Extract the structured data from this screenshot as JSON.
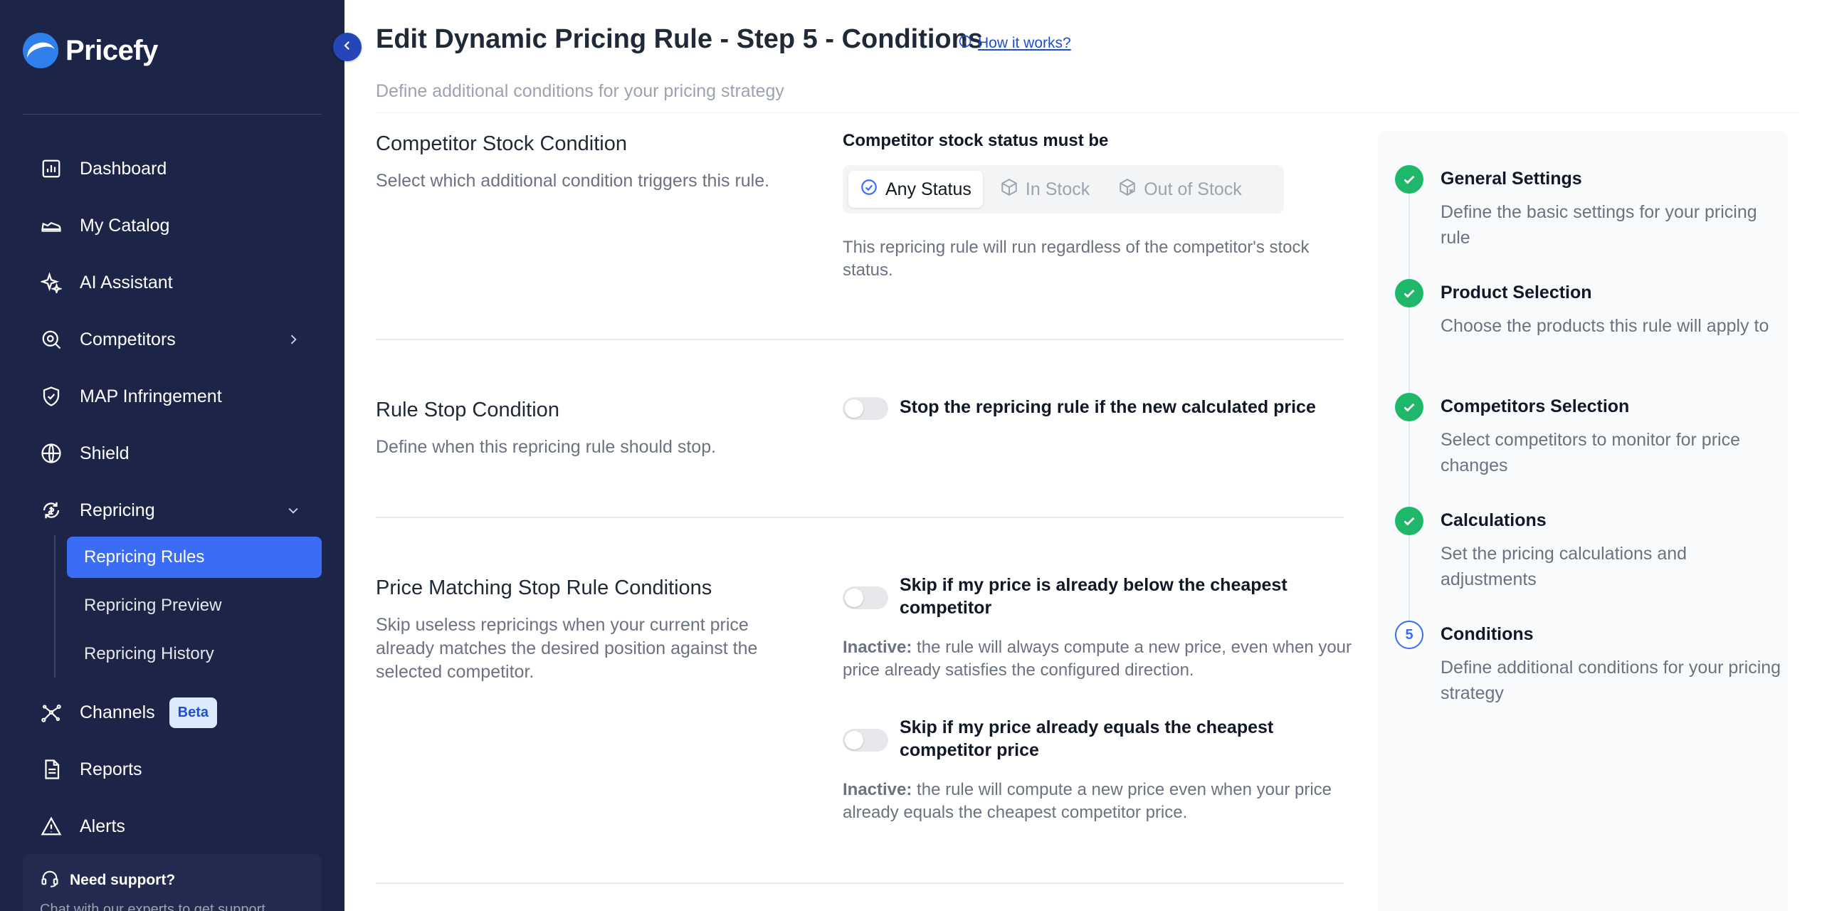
{
  "app": {
    "name": "Pricefy"
  },
  "sidebar": {
    "items": [
      {
        "label": "Dashboard"
      },
      {
        "label": "My Catalog"
      },
      {
        "label": "AI Assistant"
      },
      {
        "label": "Competitors"
      },
      {
        "label": "MAP Infringement"
      },
      {
        "label": "Shield"
      },
      {
        "label": "Repricing"
      },
      {
        "label": "Channels",
        "badge": "Beta"
      },
      {
        "label": "Reports"
      },
      {
        "label": "Alerts"
      }
    ],
    "repricing_sub": [
      {
        "label": "Repricing Rules",
        "active": true
      },
      {
        "label": "Repricing Preview"
      },
      {
        "label": "Repricing History"
      }
    ],
    "support": {
      "title": "Need support?",
      "subtitle": "Chat with our experts to get support."
    }
  },
  "header": {
    "title": "Edit Dynamic Pricing Rule - Step 5 - Conditions",
    "how_link": "How it works?",
    "subtitle": "Define additional conditions for your pricing strategy"
  },
  "sections": {
    "competitor_stock": {
      "title": "Competitor Stock Condition",
      "desc": "Select which additional condition triggers this rule.",
      "field_label": "Competitor stock status must be",
      "options": [
        "Any Status",
        "In Stock",
        "Out of Stock"
      ],
      "selected": "Any Status",
      "help": "This repricing rule will run regardless of the competitor's stock status."
    },
    "rule_stop": {
      "title": "Rule Stop Condition",
      "desc": "Define when this repricing rule should stop.",
      "toggle_label": "Stop the repricing rule if the new calculated price"
    },
    "price_matching": {
      "title": "Price Matching Stop Rule Conditions",
      "desc": "Skip useless repricings when your current price already matches the desired position against the selected competitor.",
      "toggle1_label": "Skip if my price is already below the cheapest competitor",
      "inactive_prefix": "Inactive:",
      "note1": "the rule will always compute a new price, even when your price already satisfies the configured direction.",
      "toggle2_label": "Skip if my price already equals the cheapest competitor price",
      "note2": "the rule will compute a new price even when your price already equals the cheapest competitor price."
    }
  },
  "steps": [
    {
      "title": "General Settings",
      "desc": "Define the basic settings for your pricing rule",
      "status": "done"
    },
    {
      "title": "Product Selection",
      "desc": "Choose the products this rule will apply to",
      "status": "done"
    },
    {
      "title": "Competitors Selection",
      "desc": "Select competitors to monitor for price changes",
      "status": "done"
    },
    {
      "title": "Calculations",
      "desc": "Set the pricing calculations and adjustments",
      "status": "done"
    },
    {
      "title": "Conditions",
      "desc": "Define additional conditions for your pricing strategy",
      "status": "current",
      "number": "5"
    }
  ],
  "colors": {
    "sidebar_bg": "#1c2547",
    "accent": "#3b6cf6",
    "success": "#1fb76a"
  }
}
